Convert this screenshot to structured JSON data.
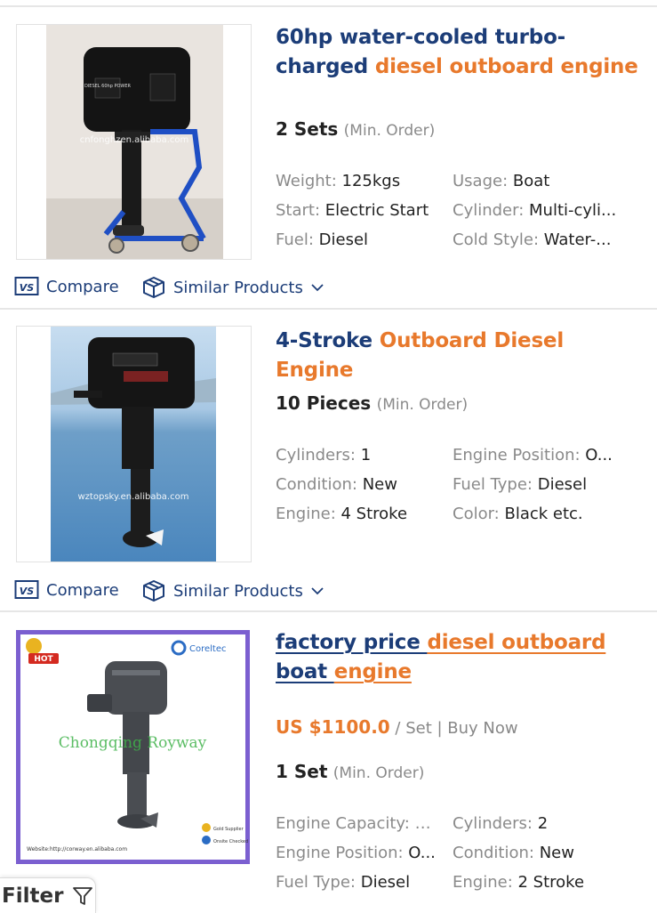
{
  "products": [
    {
      "title_parts": [
        {
          "text": "60hp water-cooled turbo-charged ",
          "highlight": false
        },
        {
          "text": "diesel outboard engine",
          "highlight": true
        }
      ],
      "moq_qty": "2 Sets",
      "moq_unit": "(Min. Order)",
      "attributes": [
        {
          "label": "Weight:",
          "value": "125kgs"
        },
        {
          "label": "Usage:",
          "value": "Boat"
        },
        {
          "label": "Start:",
          "value": "Electric Start"
        },
        {
          "label": "Cylinder:",
          "value": "Multi-cyli..."
        },
        {
          "label": "Fuel:",
          "value": "Diesel"
        },
        {
          "label": "Cold Style:",
          "value": "Water-..."
        }
      ],
      "image_watermark": "cnfonghzen.alibaba.com",
      "engine_badge": "DIESEL 60hp POWER",
      "actions": {
        "compare": "Compare",
        "similar": "Similar Products"
      }
    },
    {
      "title_parts": [
        {
          "text": "4-Stroke ",
          "highlight": false
        },
        {
          "text": "Outboard Diesel Engine",
          "highlight": true
        }
      ],
      "moq_qty": "10 Pieces",
      "moq_unit": "(Min. Order)",
      "attributes": [
        {
          "label": "Cylinders:",
          "value": "1"
        },
        {
          "label": "Engine Position:",
          "value": "O..."
        },
        {
          "label": "Condition:",
          "value": "New"
        },
        {
          "label": "Fuel Type:",
          "value": "Diesel"
        },
        {
          "label": "Engine:",
          "value": "4 Stroke"
        },
        {
          "label": "Color:",
          "value": "Black etc."
        }
      ],
      "image_watermark": "wztopsky.en.alibaba.com",
      "actions": {
        "compare": "Compare",
        "similar": "Similar Products"
      }
    },
    {
      "title_parts": [
        {
          "text": "factory price ",
          "highlight": false
        },
        {
          "text": "diesel outboard",
          "highlight": true
        },
        {
          "text": " boat ",
          "highlight": false
        },
        {
          "text": "engine",
          "highlight": true
        }
      ],
      "price_amount": "US $1100.0",
      "price_suffix": " / Set | Buy Now",
      "moq_qty": "1 Set",
      "moq_unit": "(Min. Order)",
      "attributes": [
        {
          "label": "Engine Capacity:",
          "value": ">..."
        },
        {
          "label": "Cylinders:",
          "value": "2"
        },
        {
          "label": "Engine Position:",
          "value": "O..."
        },
        {
          "label": "Condition:",
          "value": "New"
        },
        {
          "label": "Fuel Type:",
          "value": "Diesel"
        },
        {
          "label": "Engine:",
          "value": "2 Stroke"
        }
      ],
      "image_brand": "Coreltec",
      "image_hot": "HOT",
      "image_watermark": "Chongqing Royway",
      "image_website": "Website:http://corway.en.alibaba.com",
      "image_gold": "Gold Supplier",
      "image_onsite": "Onsite Checked"
    }
  ],
  "filter": {
    "label": "Filter"
  },
  "colors": {
    "navy": "#1c3d78",
    "orange": "#e8792c",
    "grey_text": "#8a8a8a",
    "frame_purple": "#7b5fd0"
  },
  "icons": {
    "compare": "vs-compare-icon",
    "similar": "cube-similar-icon",
    "chevron": "chevron-down-icon",
    "filter": "funnel-filter-icon"
  }
}
